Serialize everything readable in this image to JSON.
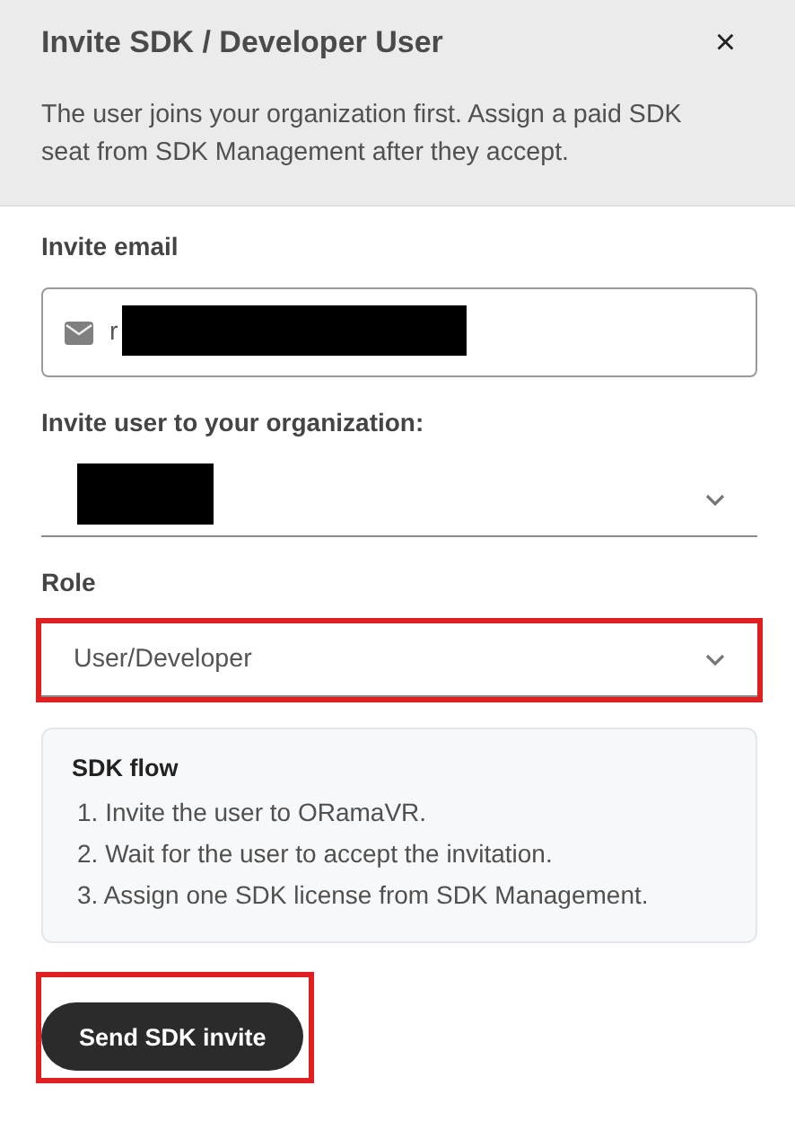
{
  "dialog": {
    "title": "Invite SDK / Developer User",
    "close": "×",
    "description": "The user joins your organization first. Assign a paid SDK seat from SDK Management after they accept."
  },
  "fields": [
    {
      "kind": "email",
      "label": "Invite email",
      "value": "r",
      "redacted": true,
      "highlighted": false
    },
    {
      "kind": "select",
      "label": "Invite user to your organization:",
      "redacted": true,
      "highlighted": false
    },
    {
      "kind": "select",
      "label": "Role",
      "value": "User/Developer",
      "redacted": false,
      "highlighted": true
    }
  ],
  "flow": {
    "title": "SDK flow",
    "steps": [
      "1. Invite the user to ORamaVR.",
      "2. Wait for the user to accept the invitation.",
      "3. Assign one SDK license from SDK Management."
    ]
  },
  "submit": {
    "label": "Send SDK invite",
    "highlighted": true
  }
}
